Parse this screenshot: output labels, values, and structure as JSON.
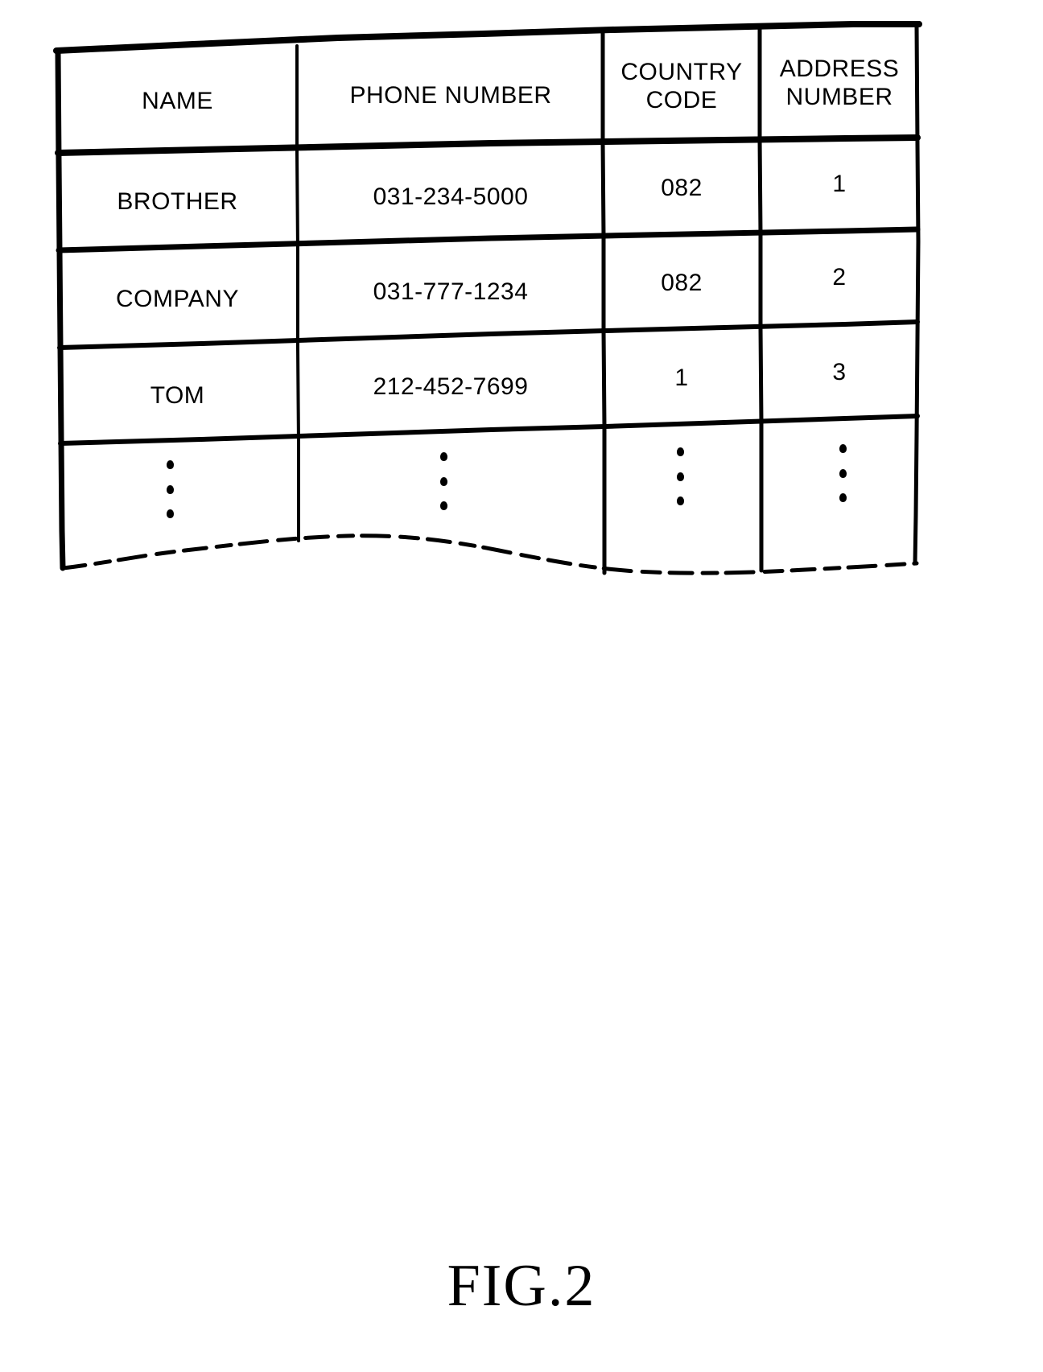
{
  "figure": {
    "caption": "FIG.2",
    "ellipsis_glyph": "vertical-ellipsis",
    "line_color": "#000000",
    "background_color": "#ffffff"
  },
  "table": {
    "columns": [
      {
        "key": "name",
        "label": "NAME"
      },
      {
        "key": "phone_number",
        "label": "PHONE NUMBER"
      },
      {
        "key": "country_code",
        "label": "COUNTRY\nCODE"
      },
      {
        "key": "address_number",
        "label": "ADDRESS\nNUMBER"
      }
    ],
    "rows": [
      {
        "name": "BROTHER",
        "phone_number": "031-234-5000",
        "country_code": "082",
        "address_number": "1"
      },
      {
        "name": "COMPANY",
        "phone_number": "031-777-1234",
        "country_code": "082",
        "address_number": "2"
      },
      {
        "name": "TOM",
        "phone_number": "212-452-7699",
        "country_code": "1",
        "address_number": "3"
      }
    ],
    "continuation_row": {
      "name": "⋮",
      "phone_number": "⋮",
      "country_code": "⋮",
      "address_number": "⋮"
    }
  },
  "chart_data": {
    "type": "table",
    "title": "FIG.2",
    "columns": [
      "NAME",
      "PHONE NUMBER",
      "COUNTRY CODE",
      "ADDRESS NUMBER"
    ],
    "rows": [
      [
        "BROTHER",
        "031-234-5000",
        "082",
        "1"
      ],
      [
        "COMPANY",
        "031-777-1234",
        "082",
        "2"
      ],
      [
        "TOM",
        "212-452-7699",
        "1",
        "3"
      ],
      [
        "⋮",
        "⋮",
        "⋮",
        "⋮"
      ]
    ]
  }
}
